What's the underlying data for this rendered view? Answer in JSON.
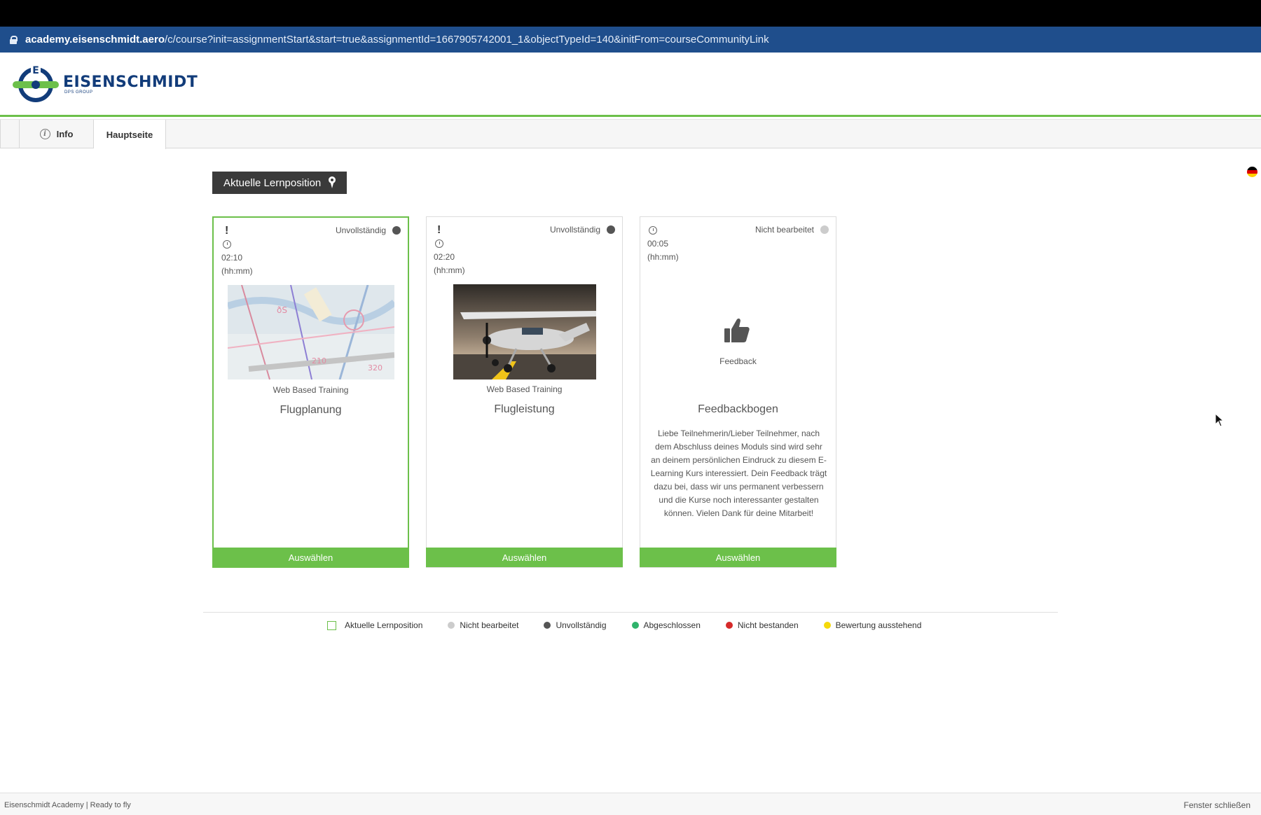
{
  "browser": {
    "url_domain": "academy.eisenschmidt.aero",
    "url_path": "/c/course?init=assignmentStart&start=true&assignmentId=1667905742001_1&objectTypeId=140&initFrom=courseCommunityLink"
  },
  "brand": {
    "name": "EISENSCHMIDT",
    "subline": "DPS GROUP",
    "colors": {
      "navy": "#123c7a",
      "green": "#6cc04a"
    }
  },
  "tabs": [
    {
      "label": "Info",
      "icon": "info-icon"
    },
    {
      "label": "Hauptseite"
    }
  ],
  "current_position_button": {
    "label": "Aktuelle Lernposition",
    "icon": "map-pin-icon"
  },
  "cards": [
    {
      "alert": "!",
      "duration": "02:10",
      "duration_unit": "(hh:mm)",
      "status": "Unvollständig",
      "status_color": "#555555",
      "type": "Web Based Training",
      "title": "Flugplanung",
      "thumbnail": "aviation-chart-image",
      "button": "Auswählen",
      "current": true
    },
    {
      "alert": "!",
      "duration": "02:20",
      "duration_unit": "(hh:mm)",
      "status": "Unvollständig",
      "status_color": "#555555",
      "type": "Web Based Training",
      "title": "Flugleistung",
      "thumbnail": "small-airplane-image",
      "button": "Auswählen",
      "current": false
    },
    {
      "duration": "00:05",
      "duration_unit": "(hh:mm)",
      "status": "Nicht bearbeitet",
      "status_color": "#cccccc",
      "icon": "thumbs-up-icon",
      "icon_label": "Feedback",
      "title": "Feedbackbogen",
      "description": "Liebe Teilnehmerin/Lieber Teilnehmer, nach dem Abschluss deines Moduls sind wird sehr an deinem persönlichen Eindruck zu diesem E-Learning Kurs interessiert. Dein Feedback trägt dazu bei, dass wir uns permanent verbessern und die Kurse noch interessanter gestalten können. Vielen Dank für deine Mitarbeit!",
      "button": "Auswählen",
      "current": false
    }
  ],
  "legend": [
    {
      "label": "Aktuelle Lernposition",
      "kind": "box",
      "color": "#6cc04a"
    },
    {
      "label": "Nicht bearbeitet",
      "kind": "dot",
      "color": "#cccccc"
    },
    {
      "label": "Unvollständig",
      "kind": "dot",
      "color": "#555555"
    },
    {
      "label": "Abgeschlossen",
      "kind": "dot",
      "color": "#2fb36b"
    },
    {
      "label": "Nicht bestanden",
      "kind": "dot",
      "color": "#d62a2a"
    },
    {
      "label": "Bewertung ausstehend",
      "kind": "dot",
      "color": "#f5d90a"
    }
  ],
  "footer": {
    "left": "Eisenschmidt Academy | Ready to fly",
    "right": "Fenster schließen"
  }
}
